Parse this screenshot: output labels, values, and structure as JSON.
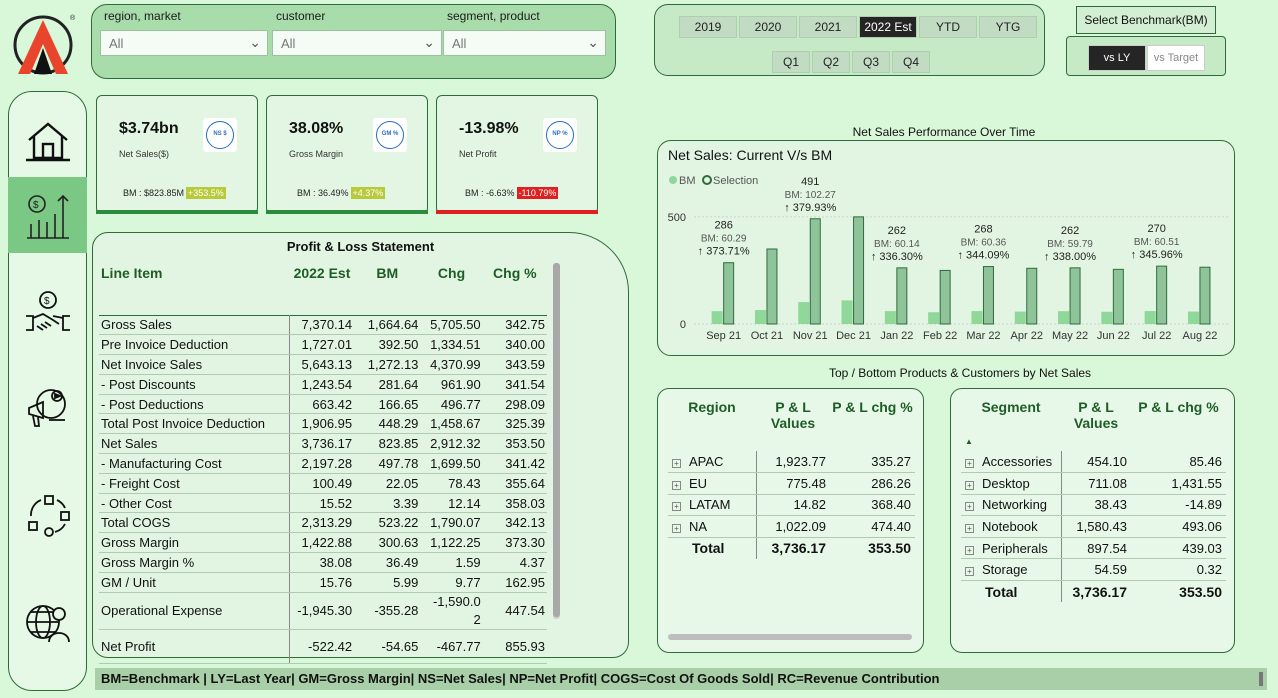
{
  "filters": [
    {
      "label": "region, market",
      "value": "All"
    },
    {
      "label": "customer",
      "value": "All"
    },
    {
      "label": "segment, product",
      "value": "All"
    }
  ],
  "years": [
    "2019",
    "2020",
    "2021",
    "2022 Est",
    "YTD",
    "YTG"
  ],
  "selected_year": "2022 Est",
  "quarters": [
    "Q1",
    "Q2",
    "Q3",
    "Q4"
  ],
  "benchmark": {
    "title": "Select Benchmark(BM)",
    "options": [
      "vs LY",
      "vs Target"
    ],
    "selected": "vs LY"
  },
  "nav_icons": [
    "home-icon",
    "sales-chart-icon",
    "handshake-icon",
    "marketing-icon",
    "supply-chain-icon",
    "global-people-icon"
  ],
  "kpis": [
    {
      "value": "$3.74bn",
      "label": "Net Sales($)",
      "icon": "NS $",
      "bm": "BM : $823.85M",
      "chg": "+353.5%",
      "chg_type": "pos",
      "accent": "#2e8b3e"
    },
    {
      "value": "38.08%",
      "label": "Gross Margin",
      "icon": "GM %",
      "bm": "BM : 36.49%",
      "chg": "+4.37%",
      "chg_type": "pos",
      "accent": "#2e8b3e"
    },
    {
      "value": "-13.98%",
      "label": "Net Profit",
      "icon": "NP %",
      "bm": "BM : -6.63%",
      "chg": "-110.79%",
      "chg_type": "neg",
      "accent": "#e02020"
    }
  ],
  "pl": {
    "title": "Profit & Loss Statement",
    "columns": [
      "Line Item",
      "2022 Est",
      "BM",
      "Chg",
      "Chg %"
    ],
    "rows": [
      [
        "Gross Sales",
        "7,370.14",
        "1,664.64",
        "5,705.50",
        "342.75"
      ],
      [
        "Pre Invoice Deduction",
        "1,727.01",
        "392.50",
        "1,334.51",
        "340.00"
      ],
      [
        "Net Invoice Sales",
        "5,643.13",
        "1,272.13",
        "4,370.99",
        "343.59"
      ],
      [
        "- Post Discounts",
        "1,243.54",
        "281.64",
        "961.90",
        "341.54"
      ],
      [
        "- Post Deductions",
        "663.42",
        "166.65",
        "496.77",
        "298.09"
      ],
      [
        "Total Post Invoice Deduction",
        "1,906.95",
        "448.29",
        "1,458.67",
        "325.39"
      ],
      [
        "Net Sales",
        "3,736.17",
        "823.85",
        "2,912.32",
        "353.50"
      ],
      [
        "- Manufacturing Cost",
        "2,197.28",
        "497.78",
        "1,699.50",
        "341.42"
      ],
      [
        "- Freight Cost",
        "100.49",
        "22.05",
        "78.43",
        "355.64"
      ],
      [
        "- Other Cost",
        "15.52",
        "3.39",
        "12.14",
        "358.03"
      ],
      [
        "Total COGS",
        "2,313.29",
        "523.22",
        "1,790.07",
        "342.13"
      ],
      [
        "Gross Margin",
        "1,422.88",
        "300.63",
        "1,122.25",
        "373.30"
      ],
      [
        "Gross Margin %",
        "38.08",
        "36.49",
        "1.59",
        "4.37"
      ],
      [
        "GM / Unit",
        "15.76",
        "5.99",
        "9.77",
        "162.95"
      ],
      [
        "Operational Expense",
        "-1,945.30",
        "-355.28",
        "-1,590.0 2",
        "447.54"
      ],
      [
        "Net Profit",
        "-522.42",
        "-54.65",
        "-467.77",
        "855.93"
      ]
    ]
  },
  "chart_data": {
    "type": "bar",
    "title": "Net Sales: Current V/s BM",
    "header": "Net Sales Performance Over Time",
    "categories": [
      "Sep 21",
      "Oct 21",
      "Nov 21",
      "Dec 21",
      "Jan 22",
      "Feb 22",
      "Mar 22",
      "Apr 22",
      "May 22",
      "Jun 22",
      "Jul 22",
      "Aug 22"
    ],
    "series": [
      {
        "name": "BM",
        "values": [
          60,
          65,
          102.27,
          110,
          60.14,
          55,
          60.36,
          58,
          59.79,
          57,
          60.51,
          58
        ],
        "color": "#8fd89a"
      },
      {
        "name": "Selection",
        "values": [
          286,
          350,
          491,
          500,
          262,
          250,
          268,
          260,
          262,
          255,
          270,
          265
        ],
        "color": "#8fc39a"
      }
    ],
    "labels": [
      {
        "index": 0,
        "value": "286",
        "bm": "BM: 60.29",
        "chg": "↑ 373.71%"
      },
      {
        "index": 2,
        "value": "491",
        "bm": "BM: 102.27",
        "chg": "↑ 379.93%"
      },
      {
        "index": 4,
        "value": "262",
        "bm": "BM: 60.14",
        "chg": "↑ 336.30%"
      },
      {
        "index": 6,
        "value": "268",
        "bm": "BM: 60.36",
        "chg": "↑ 344.09%"
      },
      {
        "index": 8,
        "value": "262",
        "bm": "BM: 59.79",
        "chg": "↑ 338.00%"
      },
      {
        "index": 10,
        "value": "270",
        "bm": "BM: 60.51",
        "chg": "↑ 345.96%"
      }
    ],
    "ylim": [
      0,
      560
    ],
    "yticks": [
      "500",
      "0"
    ]
  },
  "tb_title": "Top / Bottom Products & Customers by Net Sales",
  "region_table": {
    "columns": [
      "Region",
      "P & L Values",
      "P & L chg %"
    ],
    "rows": [
      [
        "APAC",
        "1,923.77",
        "335.27"
      ],
      [
        "EU",
        "775.48",
        "286.26"
      ],
      [
        "LATAM",
        "14.82",
        "368.40"
      ],
      [
        "NA",
        "1,022.09",
        "474.40"
      ]
    ],
    "total": [
      "Total",
      "3,736.17",
      "353.50"
    ]
  },
  "segment_table": {
    "columns": [
      "Segment",
      "P & L Values",
      "P & L chg %"
    ],
    "rows": [
      [
        "Accessories",
        "454.10",
        "85.46"
      ],
      [
        "Desktop",
        "711.08",
        "1,431.55"
      ],
      [
        "Networking",
        "38.43",
        "-14.89"
      ],
      [
        "Notebook",
        "1,580.43",
        "493.06"
      ],
      [
        "Peripherals",
        "897.54",
        "439.03"
      ],
      [
        "Storage",
        "54.59",
        "0.32"
      ]
    ],
    "total": [
      "Total",
      "3,736.17",
      "353.50"
    ]
  },
  "footer": "BM=Benchmark | LY=Last Year| GM=Gross Margin| NS=Net Sales| NP=Net Profit| COGS=Cost Of Goods Sold| RC=Revenue Contribution"
}
